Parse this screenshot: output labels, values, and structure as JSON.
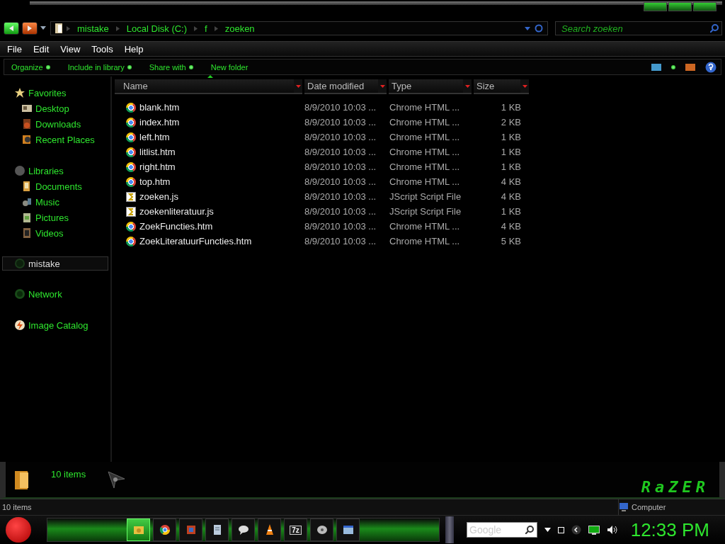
{
  "address_bar": {
    "crumbs": [
      "mistake",
      "Local Disk (C:)",
      "f",
      "zoeken"
    ]
  },
  "search": {
    "placeholder": "Search zoeken"
  },
  "menu_bar": [
    "File",
    "Edit",
    "View",
    "Tools",
    "Help"
  ],
  "command_bar": [
    {
      "label": "Organize",
      "has_menu": true
    },
    {
      "label": "Include in library",
      "has_menu": true
    },
    {
      "label": "Share with",
      "has_menu": true
    },
    {
      "label": "New folder",
      "has_menu": false
    }
  ],
  "sidebar": {
    "groups": [
      {
        "label": "Favorites",
        "kind": "star",
        "selected": false,
        "children": [
          {
            "label": "Desktop",
            "kind": "desktop",
            "selected": false
          },
          {
            "label": "Downloads",
            "kind": "downloads",
            "selected": false
          },
          {
            "label": "Recent Places",
            "kind": "recent",
            "selected": false
          }
        ]
      },
      {
        "label": "Libraries",
        "kind": "libraries",
        "selected": false,
        "children": [
          {
            "label": "Documents",
            "kind": "documents",
            "selected": false
          },
          {
            "label": "Music",
            "kind": "music",
            "selected": false
          },
          {
            "label": "Pictures",
            "kind": "pictures",
            "selected": false
          },
          {
            "label": "Videos",
            "kind": "videos",
            "selected": false
          }
        ]
      },
      {
        "label": "mistake",
        "kind": "computer",
        "selected": true
      },
      {
        "label": "Network",
        "kind": "network",
        "selected": false
      },
      {
        "label": "Image Catalog",
        "kind": "catalog",
        "selected": false
      }
    ]
  },
  "table": {
    "columns": [
      "Name",
      "Date modified",
      "Type",
      "Size"
    ],
    "rows": [
      {
        "name": "blank.htm",
        "kind": "chrome",
        "date": "8/9/2010 10:03 ...",
        "type": "Chrome HTML ...",
        "size": "1 KB"
      },
      {
        "name": "index.htm",
        "kind": "chrome",
        "date": "8/9/2010 10:03 ...",
        "type": "Chrome HTML ...",
        "size": "2 KB"
      },
      {
        "name": "left.htm",
        "kind": "chrome",
        "date": "8/9/2010 10:03 ...",
        "type": "Chrome HTML ...",
        "size": "1 KB"
      },
      {
        "name": "litlist.htm",
        "kind": "chrome",
        "date": "8/9/2010 10:03 ...",
        "type": "Chrome HTML ...",
        "size": "1 KB"
      },
      {
        "name": "right.htm",
        "kind": "chrome",
        "date": "8/9/2010 10:03 ...",
        "type": "Chrome HTML ...",
        "size": "1 KB"
      },
      {
        "name": "top.htm",
        "kind": "chrome",
        "date": "8/9/2010 10:03 ...",
        "type": "Chrome HTML ...",
        "size": "4 KB"
      },
      {
        "name": "zoeken.js",
        "kind": "script",
        "date": "8/9/2010 10:03 ...",
        "type": "JScript Script File",
        "size": "4 KB"
      },
      {
        "name": "zoekenliteratuur.js",
        "kind": "script",
        "date": "8/9/2010 10:03 ...",
        "type": "JScript Script File",
        "size": "1 KB"
      },
      {
        "name": "ZoekFuncties.htm",
        "kind": "chrome",
        "date": "8/9/2010 10:03 ...",
        "type": "Chrome HTML ...",
        "size": "4 KB"
      },
      {
        "name": "ZoekLiteratuurFuncties.htm",
        "kind": "chrome",
        "date": "8/9/2010 10:03 ...",
        "type": "Chrome HTML ...",
        "size": "5 KB"
      }
    ]
  },
  "details_pane": {
    "count": "10 items",
    "brand_logo": "RaZER"
  },
  "status_bar": {
    "count": "10 items",
    "location": "Computer"
  },
  "taskbar": {
    "apps": [
      {
        "kind": "folder",
        "selected": true
      },
      {
        "kind": "chrome",
        "selected": false
      },
      {
        "kind": "paint",
        "selected": false
      },
      {
        "kind": "notepad",
        "selected": false
      },
      {
        "kind": "chat",
        "selected": false
      },
      {
        "kind": "cone",
        "selected": false
      },
      {
        "kind": "archive",
        "label": "7z",
        "selected": false
      },
      {
        "kind": "disk",
        "selected": false
      },
      {
        "kind": "window",
        "selected": false
      }
    ],
    "search": {
      "placeholder": "Google"
    },
    "clock": "12:33 PM"
  }
}
